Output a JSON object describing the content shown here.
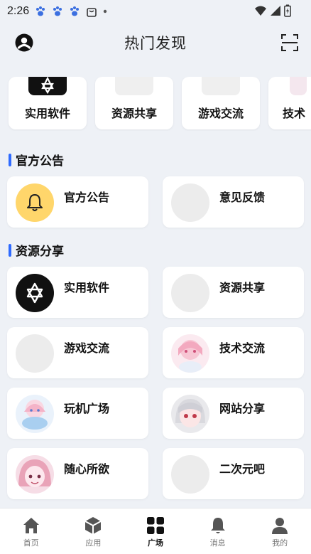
{
  "status_bar": {
    "time": "2:26"
  },
  "header": {
    "title": "热门发现"
  },
  "categories": [
    {
      "label": "实用软件",
      "icon": "dark-logo"
    },
    {
      "label": "资源共享",
      "icon": "placeholder"
    },
    {
      "label": "游戏交流",
      "icon": "placeholder"
    },
    {
      "label": "技术",
      "icon": "anime-avatar"
    }
  ],
  "sections": [
    {
      "title": "官方公告",
      "items": [
        {
          "label": "官方公告",
          "icon": "bell-icon"
        },
        {
          "label": "意见反馈",
          "icon": "placeholder"
        }
      ]
    },
    {
      "title": "资源分享",
      "items": [
        {
          "label": "实用软件",
          "icon": "dark-logo"
        },
        {
          "label": "资源共享",
          "icon": "placeholder"
        },
        {
          "label": "游戏交流",
          "icon": "placeholder"
        },
        {
          "label": "技术交流",
          "icon": "anime-avatar"
        },
        {
          "label": "玩机广场",
          "icon": "anime-avatar"
        },
        {
          "label": "网站分享",
          "icon": "anime-avatar"
        },
        {
          "label": "随心所欲",
          "icon": "anime-avatar"
        },
        {
          "label": "二次元吧",
          "icon": "placeholder"
        }
      ]
    }
  ],
  "bottom_nav": [
    {
      "label": "首页",
      "icon": "home-icon"
    },
    {
      "label": "应用",
      "icon": "box-icon"
    },
    {
      "label": "广场",
      "icon": "grid-icon",
      "active": true
    },
    {
      "label": "消息",
      "icon": "bell-icon"
    },
    {
      "label": "我的",
      "icon": "person-icon"
    }
  ],
  "colors": {
    "accent": "#2f6bff",
    "bell_bg": "#ffd66b",
    "background": "#eef1f6"
  }
}
